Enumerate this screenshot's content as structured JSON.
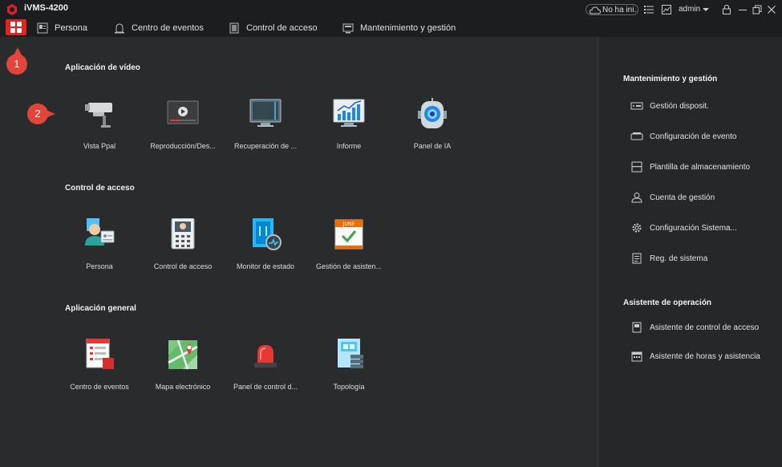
{
  "titlebar": {
    "app_title": "iVMS-4200",
    "cloud_status": "No ha ini...",
    "user": "admin",
    "icons": [
      "cloud-icon",
      "list-icon",
      "image-icon",
      "lock-icon",
      "minimize-icon",
      "restore-icon",
      "close-icon"
    ]
  },
  "tabs": [
    {
      "label": "Persona",
      "icon": "person-card-icon"
    },
    {
      "label": "Centro de eventos",
      "icon": "alarm-icon"
    },
    {
      "label": "Control de acceso",
      "icon": "door-icon"
    },
    {
      "label": "Mantenimiento y gestión",
      "icon": "maintenance-icon"
    }
  ],
  "sections": {
    "video": {
      "title": "Aplicación de vídeo",
      "tiles": [
        {
          "label": "Vista Ppal",
          "icon": "camera-icon"
        },
        {
          "label": "Reproducción/Des...",
          "icon": "playback-icon"
        },
        {
          "label": "Recuperación de ...",
          "icon": "monitor-icon"
        },
        {
          "label": "Informe",
          "icon": "report-icon"
        },
        {
          "label": "Panel de IA",
          "icon": "ai-robot-icon"
        }
      ]
    },
    "access": {
      "title": "Control de acceso",
      "tiles": [
        {
          "label": "Persona",
          "icon": "person-icon"
        },
        {
          "label": "Control de acceso",
          "icon": "intercom-icon"
        },
        {
          "label": "Monitor de estado",
          "icon": "door-monitor-icon"
        },
        {
          "label": "Gestión de asisten...",
          "icon": "calendar-icon",
          "calendar_text": "JUNE"
        }
      ]
    },
    "general": {
      "title": "Aplicación general",
      "tiles": [
        {
          "label": "Centro de eventos",
          "icon": "event-list-icon"
        },
        {
          "label": "Mapa electrónico",
          "icon": "map-icon"
        },
        {
          "label": "Panel de control d...",
          "icon": "siren-icon"
        },
        {
          "label": "Topología",
          "icon": "topology-icon"
        }
      ]
    }
  },
  "right_panel": {
    "maint_title": "Mantenimiento y gestión",
    "maint_items": [
      {
        "label": "Gestión disposit.",
        "icon": "device-icon"
      },
      {
        "label": "Configuración de evento",
        "icon": "event-config-icon"
      },
      {
        "label": "Plantilla de almacenamiento",
        "icon": "storage-icon"
      },
      {
        "label": "Cuenta de gestión",
        "icon": "account-icon"
      },
      {
        "label": "Configuración Sistema...",
        "icon": "gear-icon"
      },
      {
        "label": "Reg. de sistema",
        "icon": "log-icon"
      }
    ],
    "assist_title": "Asistente de operación",
    "assist_items": [
      {
        "label": "Asistente de control de acceso",
        "icon": "access-wizard-icon"
      },
      {
        "label": "Asistente de horas y asistencia",
        "icon": "attendance-wizard-icon"
      }
    ]
  },
  "annotations": [
    "1",
    "2"
  ],
  "colors": {
    "accent": "#e3231e",
    "background": "#2a2b2d",
    "annotation": "#e2453a"
  }
}
